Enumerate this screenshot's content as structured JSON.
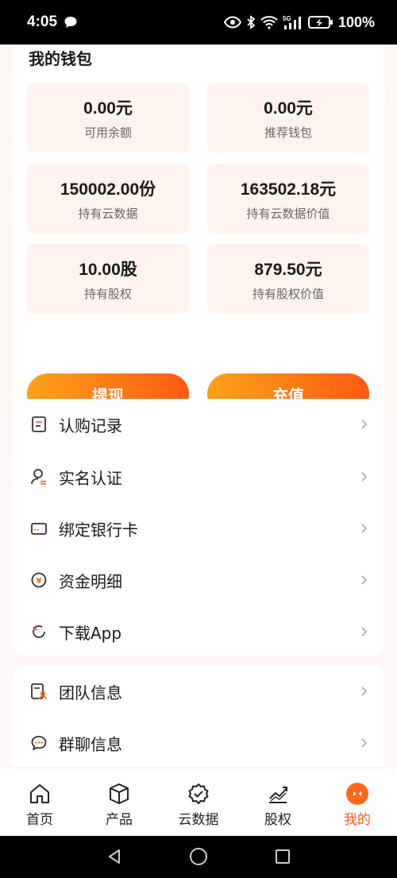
{
  "status_bar": {
    "time": "4:05",
    "battery": "100%",
    "network": "5G"
  },
  "wallet": {
    "title": "我的钱包",
    "stats": [
      {
        "value": "0.00元",
        "label": "可用余额"
      },
      {
        "value": "0.00元",
        "label": "推荐钱包"
      },
      {
        "value": "150002.00份",
        "label": "持有云数据"
      },
      {
        "value": "163502.18元",
        "label": "持有云数据价值"
      },
      {
        "value": "10.00股",
        "label": "持有股权"
      },
      {
        "value": "879.50元",
        "label": "持有股权价值"
      }
    ],
    "withdraw_label": "提现",
    "recharge_label": "充值"
  },
  "menu1": [
    {
      "label": "认购记录",
      "icon": "document-icon"
    },
    {
      "label": "实名认证",
      "icon": "user-verify-icon"
    },
    {
      "label": "绑定银行卡",
      "icon": "bank-card-icon"
    },
    {
      "label": "资金明细",
      "icon": "yuan-coin-icon"
    },
    {
      "label": "下载App",
      "icon": "refresh-download-icon"
    }
  ],
  "menu2": [
    {
      "label": "团队信息",
      "icon": "team-info-icon"
    },
    {
      "label": "群聊信息",
      "icon": "chat-bubble-icon"
    }
  ],
  "tabs": [
    {
      "label": "首页",
      "icon": "home-icon"
    },
    {
      "label": "产品",
      "icon": "box-icon"
    },
    {
      "label": "云数据",
      "icon": "badge-check-icon"
    },
    {
      "label": "股权",
      "icon": "trend-chart-icon"
    },
    {
      "label": "我的",
      "icon": "profile-face-icon",
      "active": true
    }
  ],
  "colors": {
    "accent": "#ff5a12",
    "accent_start": "#fca21a",
    "stat_bg": "#fff3ef"
  }
}
